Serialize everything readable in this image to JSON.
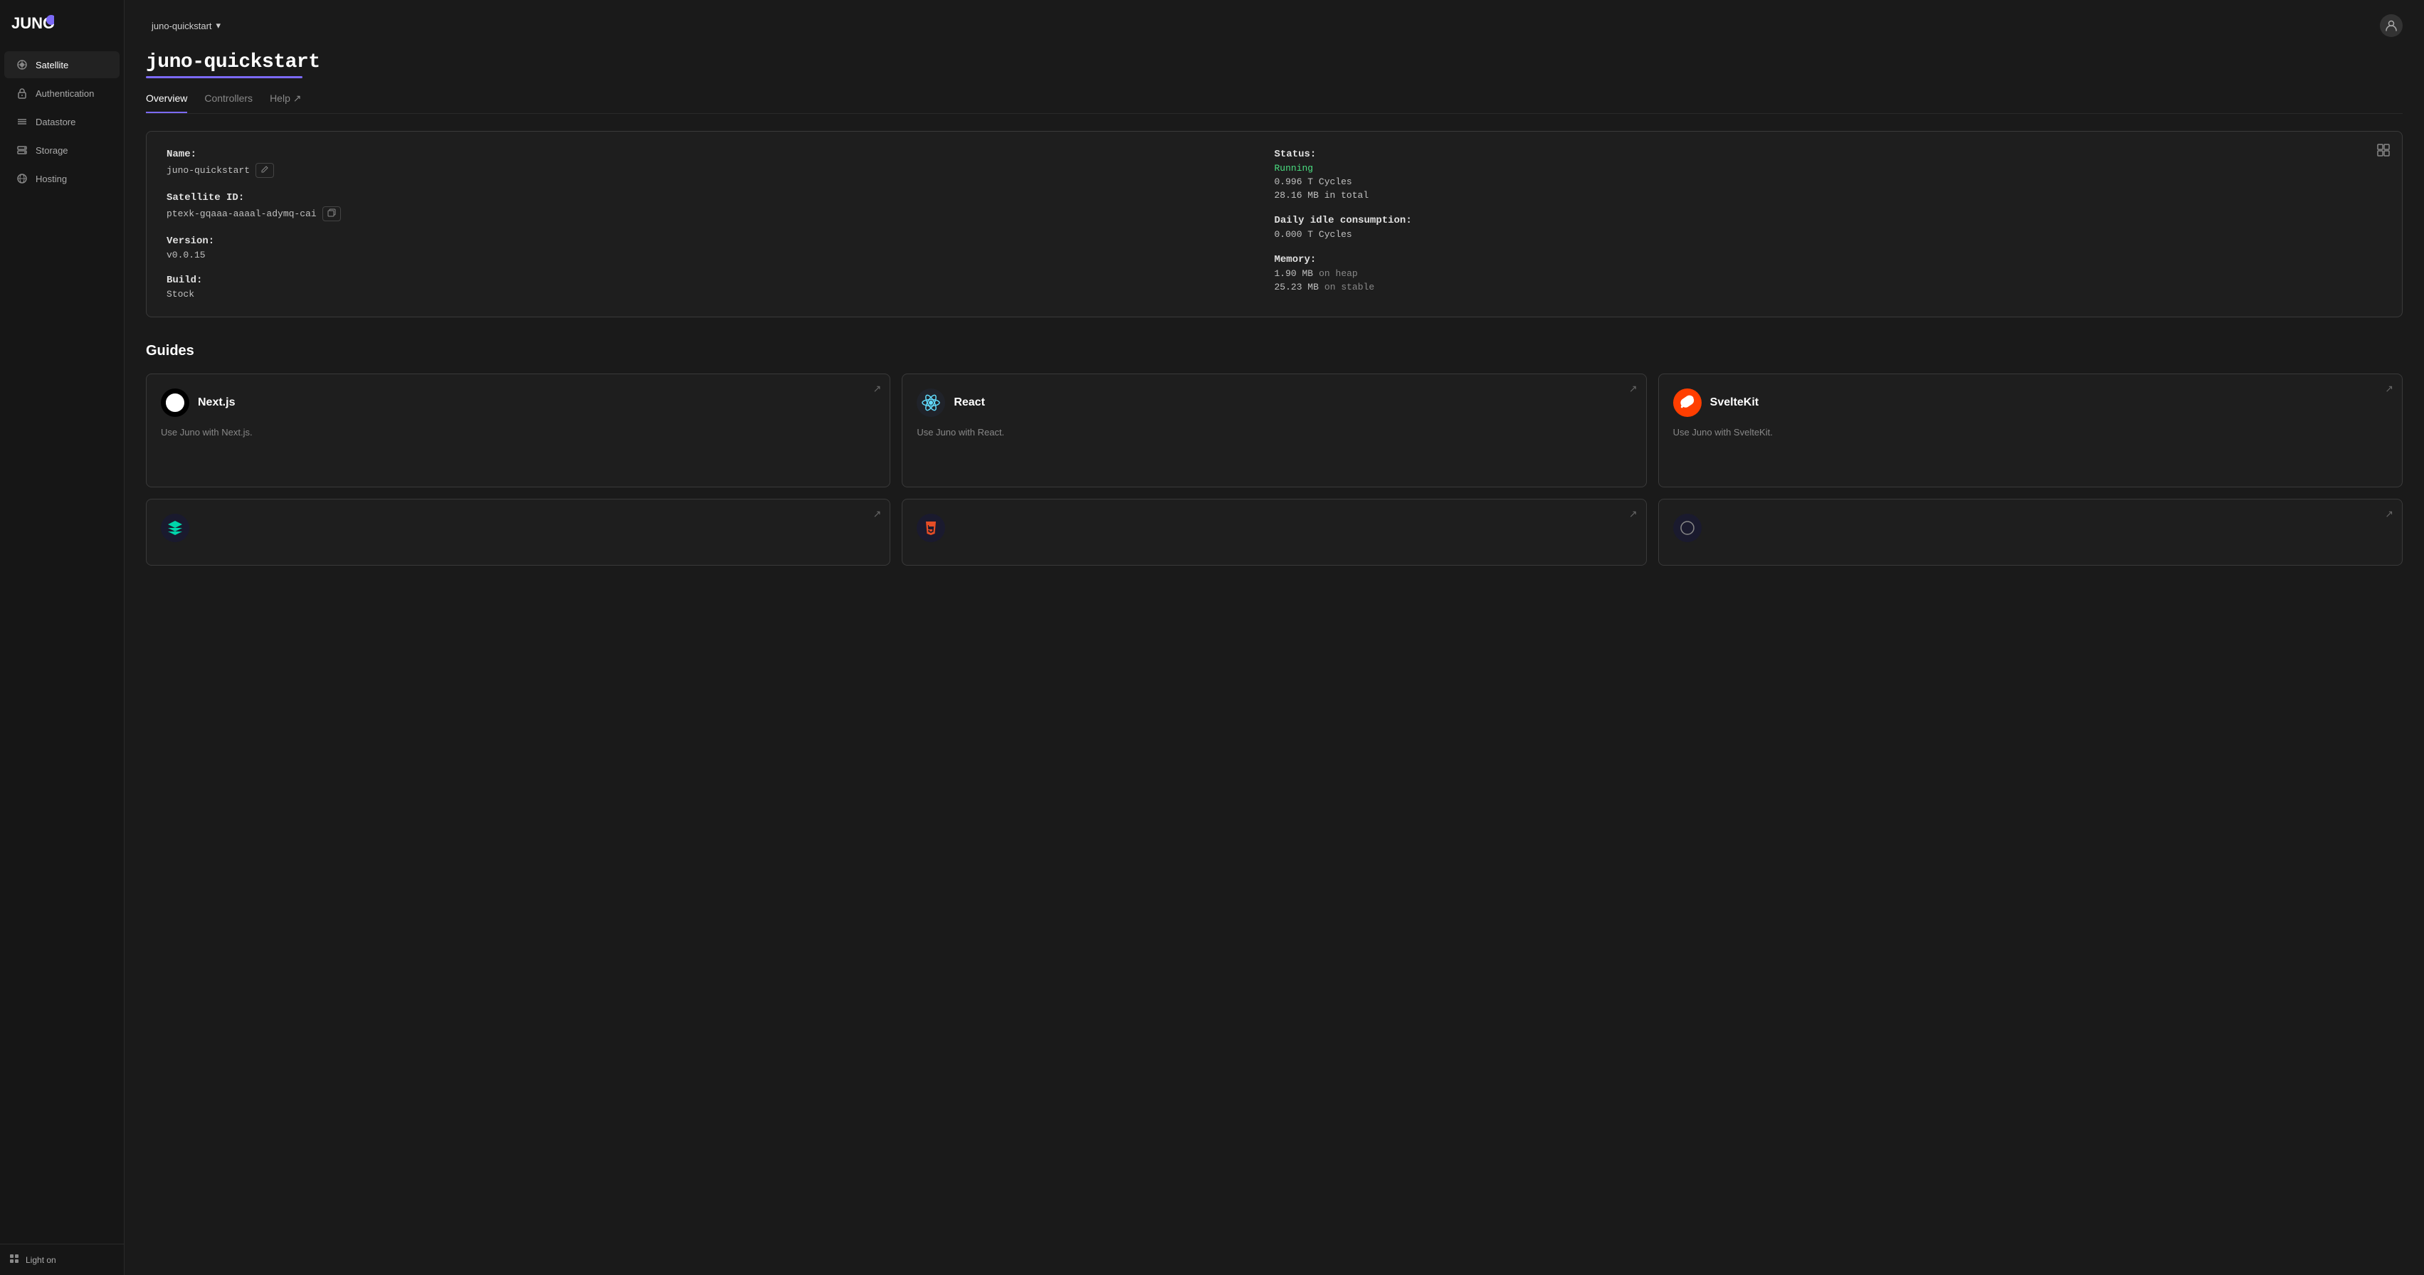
{
  "logo": {
    "text": "JUNO",
    "dot_color": "#7c6af7"
  },
  "topbar": {
    "satellite_selector": "juno-quickstart",
    "dropdown_icon": "▾"
  },
  "sidebar": {
    "items": [
      {
        "id": "satellite",
        "label": "Satellite",
        "active": true
      },
      {
        "id": "authentication",
        "label": "Authentication",
        "active": false
      },
      {
        "id": "datastore",
        "label": "Datastore",
        "active": false
      },
      {
        "id": "storage",
        "label": "Storage",
        "active": false
      },
      {
        "id": "hosting",
        "label": "Hosting",
        "active": false
      }
    ],
    "bottom": {
      "label": "Light on",
      "icon": "☀"
    }
  },
  "page": {
    "title": "juno-quickstart",
    "tabs": [
      {
        "label": "Overview",
        "active": true,
        "link": false
      },
      {
        "label": "Controllers",
        "active": false,
        "link": false
      },
      {
        "label": "Help ↗",
        "active": false,
        "link": true
      }
    ]
  },
  "info_card": {
    "name_label": "Name:",
    "name_value": "juno-quickstart",
    "satellite_id_label": "Satellite ID:",
    "satellite_id_value": "ptexk-gqaaa-aaaal-adymq-cai",
    "version_label": "Version:",
    "version_value": "v0.0.15",
    "build_label": "Build:",
    "build_value": "Stock",
    "status_label": "Status:",
    "status_value": "Running",
    "cycles_value": "0.996 T Cycles",
    "total_value": "28.16 MB in total",
    "daily_idle_label": "Daily idle consumption:",
    "daily_idle_value": "0.000 T Cycles",
    "memory_label": "Memory:",
    "memory_heap": "1.90 MB",
    "memory_heap_label": "on heap",
    "memory_stable": "25.23 MB",
    "memory_stable_label": "on stable"
  },
  "guides": {
    "section_title": "Guides",
    "items": [
      {
        "id": "nextjs",
        "name": "Next.js",
        "description": "Use Juno with Next.js.",
        "logo_type": "nextjs",
        "logo_text": "N"
      },
      {
        "id": "react",
        "name": "React",
        "description": "Use Juno with React.",
        "logo_type": "react",
        "logo_text": "⚛"
      },
      {
        "id": "sveltekit",
        "name": "SvelteKit",
        "description": "Use Juno with SvelteKit.",
        "logo_type": "svelte",
        "logo_text": "S"
      }
    ]
  }
}
